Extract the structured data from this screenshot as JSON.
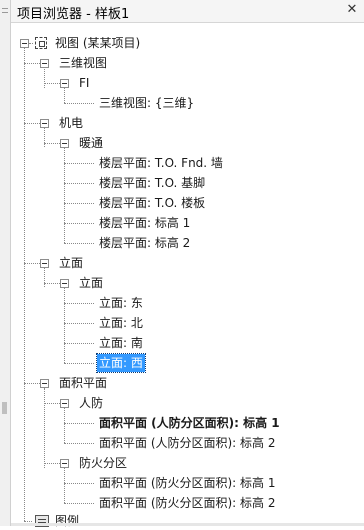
{
  "window": {
    "title": "项目浏览器 - 样板1",
    "close_glyph": "✕"
  },
  "tree": {
    "root": "视图 (某某项目)",
    "three_d_group": "三维视图",
    "fi_node": "FI",
    "three_d_view": "三维视图: {三维}",
    "mep_group": "机电",
    "hvac_group": "暖通",
    "hvac_items": [
      "楼层平面: T.O. Fnd. 墙",
      "楼层平面: T.O. 基脚",
      "楼层平面: T.O. 楼板",
      "楼层平面: 标高 1",
      "楼层平面: 标高 2"
    ],
    "elev_group": "立面",
    "elev_sub": "立面",
    "elev_items": [
      "立面: 东",
      "立面: 北",
      "立面: 南",
      "立面: 西"
    ],
    "selected_item": "立面: 西",
    "area_group": "面积平面",
    "civil_defense": "人防",
    "civil_items": [
      "面积平面 (人防分区面积): 标高 1",
      "面积平面 (人防分区面积): 标高 2"
    ],
    "fire_zone": "防火分区",
    "fire_items": [
      "面积平面 (防火分区面积): 标高 1",
      "面积平面 (防火分区面积): 标高 2"
    ],
    "legend": "图例"
  }
}
